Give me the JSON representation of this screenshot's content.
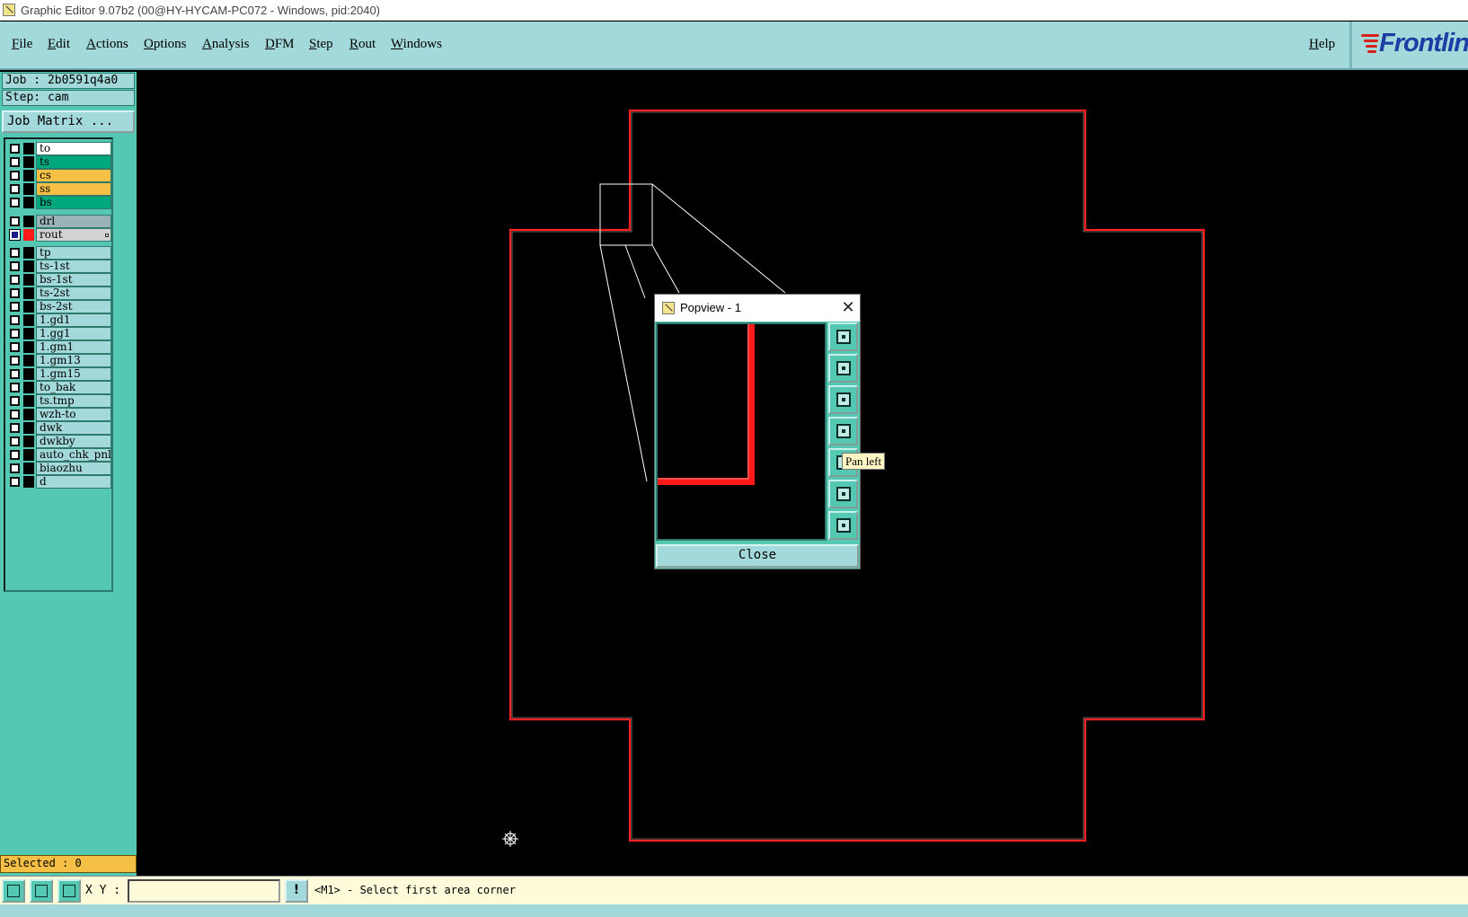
{
  "window": {
    "title": "Graphic Editor 9.07b2 (00@HY-HYCAM-PC072 - Windows, pid:2040)"
  },
  "menubar": {
    "items": [
      "File",
      "Edit",
      "Actions",
      "Options",
      "Analysis",
      "DFM",
      "Step",
      "Rout",
      "Windows"
    ],
    "help": "Help",
    "logo_text": "Frontline"
  },
  "leftpanel": {
    "job": "Job : 2b0591q4a0",
    "step": "Step: cam",
    "job_matrix_label": "Job Matrix ...",
    "selected": "Selected : 0"
  },
  "layers": [
    {
      "name": "to",
      "color": "#ffffff",
      "active": false
    },
    {
      "name": "ts",
      "color": "#00a87c",
      "active": false
    },
    {
      "name": "cs",
      "color": "#f6c047",
      "active": false
    },
    {
      "name": "ss",
      "color": "#f6c047",
      "active": false
    },
    {
      "name": "bs",
      "color": "#00a87c",
      "active": false
    },
    {
      "name": "drl",
      "color": "#9ab3b8",
      "active": false
    },
    {
      "name": "rout",
      "color": "#d3d3d3",
      "active": true,
      "swatch": "#ff1a1a"
    },
    {
      "name": "tp",
      "color": "#a3d9db",
      "active": false
    },
    {
      "name": "ts-1st",
      "color": "#a3d9db",
      "active": false
    },
    {
      "name": "bs-1st",
      "color": "#a3d9db",
      "active": false
    },
    {
      "name": "ts-2st",
      "color": "#a3d9db",
      "active": false
    },
    {
      "name": "bs-2st",
      "color": "#a3d9db",
      "active": false
    },
    {
      "name": "1.gd1",
      "color": "#a3d9db",
      "active": false
    },
    {
      "name": "1.gg1",
      "color": "#a3d9db",
      "active": false
    },
    {
      "name": "1.gm1",
      "color": "#a3d9db",
      "active": false
    },
    {
      "name": "1.gm13",
      "color": "#a3d9db",
      "active": false
    },
    {
      "name": "1.gm15",
      "color": "#a3d9db",
      "active": false
    },
    {
      "name": "to_bak",
      "color": "#a3d9db",
      "active": false
    },
    {
      "name": "ts.tmp",
      "color": "#a3d9db",
      "active": false
    },
    {
      "name": "wzh-to",
      "color": "#a3d9db",
      "active": false
    },
    {
      "name": "dwk",
      "color": "#a3d9db",
      "active": false
    },
    {
      "name": "dwkby",
      "color": "#a3d9db",
      "active": false
    },
    {
      "name": "auto_chk_pnl",
      "color": "#a3d9db",
      "active": false
    },
    {
      "name": "biaozhu",
      "color": "#a3d9db",
      "active": false
    },
    {
      "name": "d",
      "color": "#a3d9db",
      "active": false
    }
  ],
  "popview": {
    "title": "Popview - 1",
    "close_label": "Close",
    "tooltip": "Pan left",
    "buttons": [
      "zoom-fit-icon",
      "pan-up-icon",
      "pan-down-icon",
      "pan-left-icon",
      "pan-right-icon",
      "zoom-in-icon",
      "zoom-out-icon"
    ]
  },
  "statusbar": {
    "xy_label": "X Y :",
    "xy_value": "",
    "warn_symbol": "!",
    "prompt": "<M1> - Select first area corner"
  },
  "colors": {
    "panel_teal": "#55c8b3",
    "menu_cyan": "#a3d9db",
    "rout_red": "#ff1a1a",
    "status_yellow": "#fdfbd9"
  }
}
